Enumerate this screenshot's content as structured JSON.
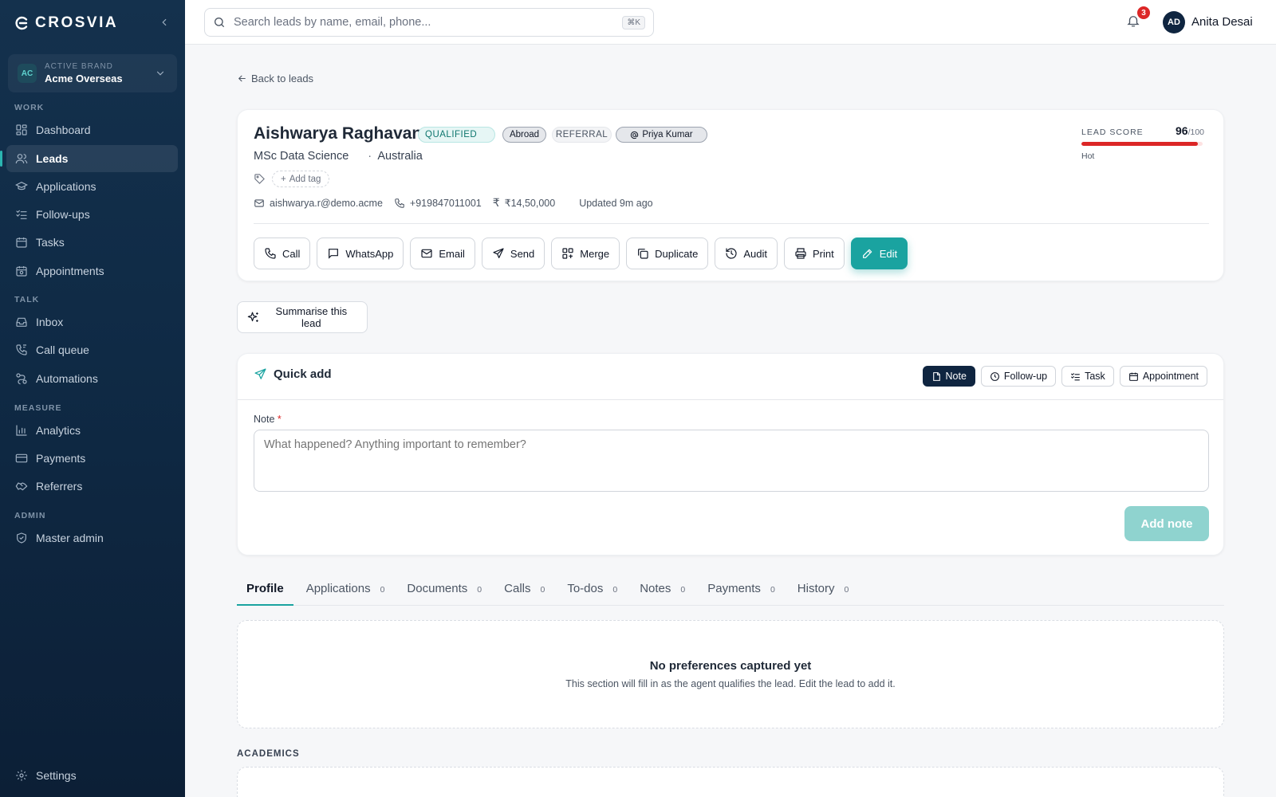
{
  "brand": {
    "logo_text": "CROSVIA"
  },
  "brand_switch": {
    "caption": "ACTIVE BRAND",
    "initials": "AC",
    "name": "Acme Overseas"
  },
  "sidebar": {
    "sections": {
      "work": "WORK",
      "talk": "TALK",
      "measure": "MEASURE",
      "admin": "ADMIN"
    },
    "items": {
      "dashboard": "Dashboard",
      "leads": "Leads",
      "applications": "Applications",
      "followups": "Follow-ups",
      "tasks": "Tasks",
      "appointments": "Appointments",
      "inbox": "Inbox",
      "callqueue": "Call queue",
      "automations": "Automations",
      "analytics": "Analytics",
      "payments": "Payments",
      "referrers": "Referrers",
      "masteradmin": "Master admin",
      "settings": "Settings"
    }
  },
  "topbar": {
    "search_placeholder": "Search leads by name, email, phone...",
    "search_shortcut": "⌘K",
    "notification_count": "3",
    "user_initials": "AD",
    "user_name": "Anita Desai"
  },
  "back_link": "Back to leads",
  "lead": {
    "name": "Aishwarya Raghavan",
    "status": "QUALIFIED",
    "destination_type": "Abroad",
    "source": "REFERRAL",
    "referrer": "Priya Kumar",
    "course": "MSc Data Science",
    "country": "Australia",
    "add_tag": "Add tag",
    "email": "aishwarya.r@demo.acme",
    "phone": "+919847011001",
    "budget": "₹14,50,000",
    "updated": "Updated 9m ago",
    "score_label": "LEAD SCORE",
    "score": "96",
    "score_max": "/100",
    "score_fraction": 0.96,
    "score_status": "Hot"
  },
  "actions": {
    "call": "Call",
    "whatsapp": "WhatsApp",
    "email": "Email",
    "send": "Send",
    "merge": "Merge",
    "duplicate": "Duplicate",
    "audit": "Audit",
    "print": "Print",
    "edit": "Edit"
  },
  "summarise_label": "Summarise this lead",
  "quick_add": {
    "title": "Quick add",
    "tabs": {
      "note": "Note",
      "followup": "Follow-up",
      "task": "Task",
      "appointment": "Appointment"
    },
    "note_label": "Note",
    "required_mark": "*",
    "note_placeholder": "What happened? Anything important to remember?",
    "submit_label": "Add note"
  },
  "detail_tabs": [
    {
      "label": "Profile",
      "count": ""
    },
    {
      "label": "Applications",
      "count": "0"
    },
    {
      "label": "Documents",
      "count": "0"
    },
    {
      "label": "Calls",
      "count": "0"
    },
    {
      "label": "To-dos",
      "count": "0"
    },
    {
      "label": "Notes",
      "count": "0"
    },
    {
      "label": "Payments",
      "count": "0"
    },
    {
      "label": "History",
      "count": "0"
    }
  ],
  "empty_state": {
    "title": "No preferences captured yet",
    "subtitle": "This section will fill in as the agent qualifies the lead. Edit the lead to add it."
  },
  "academics_label": "ACADEMICS",
  "colors": {
    "accent": "#1aa3a0",
    "sidebar": "#0f2a45",
    "danger": "#dc2626"
  }
}
